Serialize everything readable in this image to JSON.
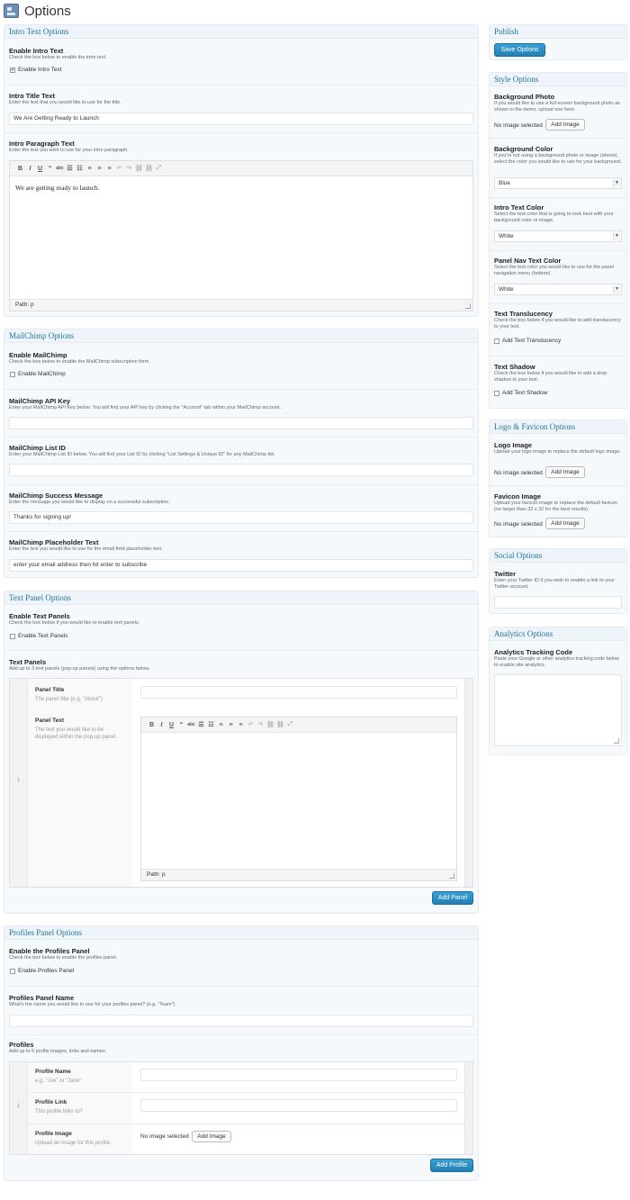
{
  "page": {
    "title": "Options"
  },
  "intro": {
    "heading": "Intro Text Options",
    "enable_label": "Enable Intro Text",
    "enable_desc": "Check the box below to enable the intro text.",
    "enable_cb": "Enable Intro Text",
    "enable_checked": true,
    "title_label": "Intro Title Text",
    "title_desc": "Enter the text that you would like to use for the title.",
    "title_value": "We Are Getting Ready to Launch",
    "para_label": "Intro Paragraph Text",
    "para_desc": "Enter the text you wish to use for your intro paragraph.",
    "para_value": "We are getting ready to launch.",
    "path": "Path: p"
  },
  "mailchimp": {
    "heading": "MailChimp Options",
    "enable_label": "Enable MailChimp",
    "enable_desc": "Check the box below to enable the MailChimp subscription form.",
    "enable_cb": "Enable MailChimp",
    "api_label": "MailChimp API Key",
    "api_desc": "Enter your MailChimp API Key below. You will find your API key by clicking the \"Account\" tab within your MailChimp account.",
    "api_value": "",
    "list_label": "MailChimp List ID",
    "list_desc": "Enter your MailChimp List ID below. You will find your List ID by clicking \"List Settings & Unique ID\" for any MailChimp list.",
    "list_value": "",
    "success_label": "MailChimp Success Message",
    "success_desc": "Enter the message you would like to display on a successful subscription.",
    "success_value": "Thanks for signing up!",
    "placeholder_label": "MailChimp Placeholder Text",
    "placeholder_desc": "Enter the text you would like to use for the email field placeholder text.",
    "placeholder_value": "enter your email address then hit enter to subscribe"
  },
  "textpanel": {
    "heading": "Text Panel Options",
    "enable_label": "Enable Text Panels",
    "enable_desc": "Check the box below if you would like to enable text panels.",
    "enable_cb": "Enable Text Panels",
    "panels_label": "Text Panels",
    "panels_desc": "Add up to 3 text panels (pop-up panels) using the options below.",
    "row_num": "1",
    "ptitle_label": "Panel Title",
    "ptitle_desc": "The panel title (e.g. \"About\")",
    "ptext_label": "Panel Text",
    "ptext_desc": "The text you would like to be displayed within the pop-up panel.",
    "path": "Path: p",
    "add_button": "Add Panel"
  },
  "profiles": {
    "heading": "Profiles Panel Options",
    "enable_label": "Enable the Profiles Panel",
    "enable_desc": "Check the box below to enable the profiles panel.",
    "enable_cb": "Enable Profiles Panel",
    "name_label": "Profiles Panel Name",
    "name_desc": "What's the name you would like to use for your profiles panel? (e.g. \"Team\")",
    "name_value": "",
    "list_label": "Profiles",
    "list_desc": "Add up to 6 profile images, links and names.",
    "row_num": "1",
    "pname_label": "Profile Name",
    "pname_desc": "e.g. \"Joe\" or \"Jane\"",
    "plink_label": "Profile Link",
    "plink_desc": "This profile links to?",
    "pimage_label": "Profile Image",
    "pimage_desc": "Upload an image for this profile.",
    "pimage_status": "No image selected",
    "pimage_button": "Add Image",
    "add_button": "Add Profile"
  },
  "publish": {
    "heading": "Publish",
    "save_button": "Save Options"
  },
  "style": {
    "heading": "Style Options",
    "bg_photo_label": "Background Photo",
    "bg_photo_desc": "If you would like to use a full-screen background photo as shown in the demo, upload one here.",
    "bg_photo_status": "No image selected",
    "bg_photo_button": "Add Image",
    "bg_color_label": "Background Color",
    "bg_color_desc": "If you're not using a background photo or image (above), select the color you would like to use for your background.",
    "bg_color_value": "Blue",
    "intro_color_label": "Intro Text Color",
    "intro_color_desc": "Select the text color that is going to look best with your background color or image.",
    "intro_color_value": "White",
    "nav_color_label": "Panel Nav Text Color",
    "nav_color_desc": "Select the text color you would like to use for the panel navigation menu (bottom).",
    "nav_color_value": "White",
    "transl_label": "Text Translucency",
    "transl_desc": "Check the box below if you would like to add translucency to your text.",
    "transl_cb": "Add Text Translucency",
    "shadow_label": "Text Shadow",
    "shadow_desc": "Check the box below if you would like to add a drop shadow to your text.",
    "shadow_cb": "Add Text Shadow"
  },
  "logo": {
    "heading": "Logo & Favicon Options",
    "logo_label": "Logo Image",
    "logo_desc": "Upload your logo image to replace the default logo image.",
    "logo_status": "No image selected",
    "logo_button": "Add Image",
    "fav_label": "Favicon Image",
    "fav_desc": "Upload your favicon image to replace the default favicon (no larger than 32 x 32 for the best results).",
    "fav_status": "No image selected",
    "fav_button": "Add Image"
  },
  "social": {
    "heading": "Social Options",
    "twitter_label": "Twitter",
    "twitter_desc": "Enter your Twitter ID if you wish to enable a link to your Twitter account.",
    "twitter_value": ""
  },
  "analytics": {
    "heading": "Analytics Options",
    "code_label": "Analytics Tracking Code",
    "code_desc": "Paste your Google or other analytics tracking code below to enable site analytics.",
    "code_value": ""
  },
  "toolbar_icons": [
    "bold-icon",
    "italic-icon",
    "underline-icon",
    "blockquote-icon",
    "strikethrough-icon",
    "bullet-list-icon",
    "numbered-list-icon",
    "align-left-icon",
    "align-center-icon",
    "align-right-icon",
    "undo-icon",
    "redo-icon",
    "link-icon",
    "unlink-icon",
    "fullscreen-icon"
  ]
}
